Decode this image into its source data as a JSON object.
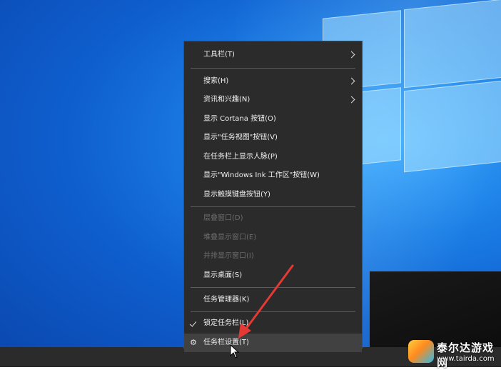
{
  "menu": {
    "items": [
      {
        "label": "工具栏(T)",
        "submenu": true,
        "disabled": false
      },
      {
        "label": "搜索(H)",
        "submenu": true,
        "disabled": false
      },
      {
        "label": "资讯和兴趣(N)",
        "submenu": true,
        "disabled": false
      },
      {
        "label": "显示 Cortana 按钮(O)",
        "submenu": false,
        "disabled": false
      },
      {
        "label": "显示\"任务视图\"按钮(V)",
        "submenu": false,
        "disabled": false
      },
      {
        "label": "在任务栏上显示人脉(P)",
        "submenu": false,
        "disabled": false
      },
      {
        "label": "显示\"Windows Ink 工作区\"按钮(W)",
        "submenu": false,
        "disabled": false
      },
      {
        "label": "显示触摸键盘按钮(Y)",
        "submenu": false,
        "disabled": false
      },
      {
        "label": "层叠窗口(D)",
        "submenu": false,
        "disabled": true
      },
      {
        "label": "堆叠显示窗口(E)",
        "submenu": false,
        "disabled": true
      },
      {
        "label": "并排显示窗口(I)",
        "submenu": false,
        "disabled": true
      },
      {
        "label": "显示桌面(S)",
        "submenu": false,
        "disabled": false
      },
      {
        "label": "任务管理器(K)",
        "submenu": false,
        "disabled": false
      },
      {
        "label": "锁定任务栏(L)",
        "submenu": false,
        "disabled": false,
        "checked": true
      },
      {
        "label": "任务栏设置(T)",
        "submenu": false,
        "disabled": false,
        "icon": "gear-icon",
        "highlighted": true
      }
    ]
  },
  "watermark": {
    "title": "泰尔达游戏网",
    "url": "www.tairda.com"
  },
  "colors": {
    "menu_bg": "#2b2b2b",
    "annotation_arrow": "#e53935",
    "desktop_blue": "#0f5fcf"
  }
}
